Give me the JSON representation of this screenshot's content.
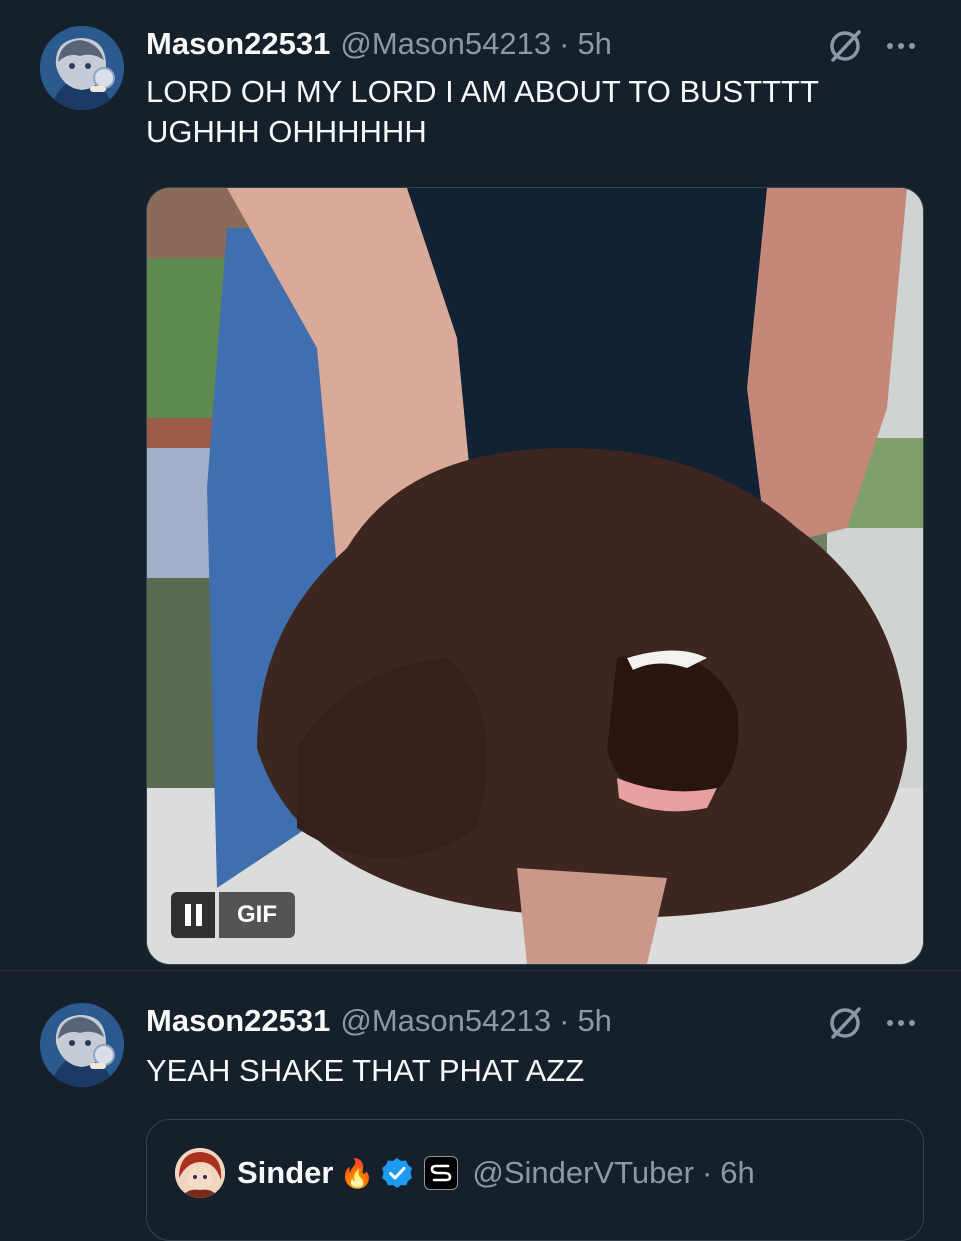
{
  "tweets": [
    {
      "display_name": "Mason22531",
      "handle": "@Mason54213",
      "separator": "·",
      "time": "5h",
      "text": "LORD OH MY LORD I AM ABOUT TO BUSTTTT UGHHH OHHHHHH",
      "avatar_icon": "anime-character-avatar",
      "grok_icon": "grok-icon",
      "more_icon": "more-options-icon",
      "media": {
        "type": "gif",
        "badge_label": "GIF",
        "playback_icon": "pause-icon"
      }
    },
    {
      "display_name": "Mason22531",
      "handle": "@Mason54213",
      "separator": "·",
      "time": "5h",
      "text": "YEAH SHAKE THAT PHAT AZZ",
      "avatar_icon": "anime-character-avatar",
      "grok_icon": "grok-icon",
      "more_icon": "more-options-icon",
      "quote": {
        "display_name": "Sinder",
        "emoji": "🔥",
        "verified": true,
        "affiliate_badge": "affiliate-badge-icon",
        "handle": "@SinderVTuber",
        "separator": "·",
        "time": "6h"
      }
    }
  ],
  "colors": {
    "background": "#15202b",
    "text_primary": "#f7f9f9",
    "text_secondary": "#8b98a5",
    "border": "#38444d",
    "verified_blue": "#1d9bf0"
  }
}
